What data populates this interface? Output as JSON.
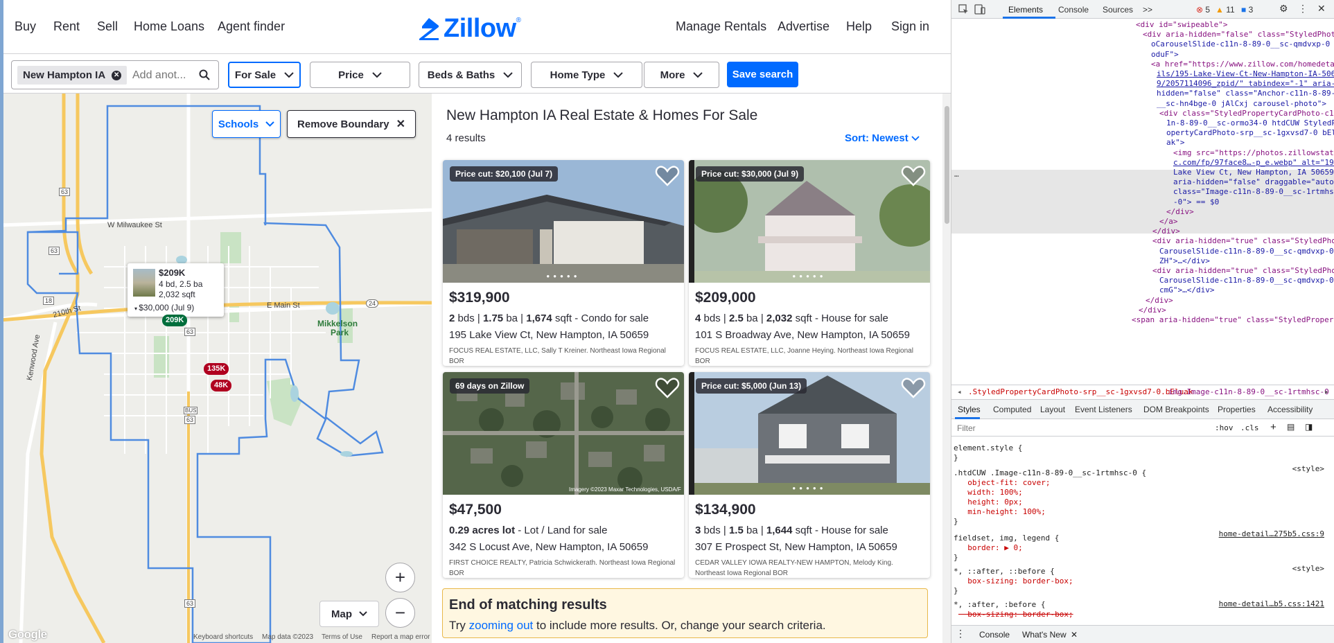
{
  "header": {
    "nav_left": [
      "Buy",
      "Rent",
      "Sell",
      "Home Loans",
      "Agent finder"
    ],
    "logo": "Zillow",
    "nav_right": [
      "Manage Rentals",
      "Advertise",
      "Help",
      "Sign in"
    ]
  },
  "filters": {
    "location_chip": "New Hampton IA",
    "search_placeholder": "Add anot...",
    "buttons": [
      "For Sale",
      "Price",
      "Beds & Baths",
      "Home Type",
      "More"
    ],
    "save_label": "Save search"
  },
  "map": {
    "schools_label": "Schools",
    "remove_boundary_label": "Remove Boundary",
    "map_type": "Map",
    "zoom_in": "+",
    "zoom_out": "−",
    "labels": {
      "milwaukee": "W Milwaukee St",
      "main": "E Main St",
      "st210": "210th St",
      "kenwood": "Kenwood Ave",
      "mikkelson1": "Mikkelson",
      "mikkelson2": "Park",
      "hwy63a": "63",
      "hwy63b": "63",
      "hwy63c": "63",
      "hwy63d": "63",
      "hwy63e": "63",
      "hwy18": "18",
      "hwy24": "24",
      "bus": "BUS"
    },
    "pins": [
      {
        "label": "209K",
        "color": "#006e3c"
      },
      {
        "label": "135K",
        "color": "#b00020"
      },
      {
        "label": "48K",
        "color": "#b00020"
      }
    ],
    "tooltip": {
      "price": "$209K",
      "beds_baths": "4 bd, 2.5 ba",
      "sqft": "2,032 sqft",
      "cut": "$30,000 (Jul 9)"
    },
    "attribution": {
      "google": "Google",
      "shortcuts": "Keyboard shortcuts",
      "data": "Map data ©2023",
      "terms": "Terms of Use",
      "report": "Report a map error"
    }
  },
  "results": {
    "title": "New Hampton IA Real Estate & Homes For Sale",
    "count": "4 results",
    "sort_label": "Sort: Newest",
    "listings": [
      {
        "badge": "Price cut: $20,100 (Jul 7)",
        "price": "$319,900",
        "beds": "2",
        "beds_unit": "bds",
        "baths": "1.75",
        "baths_unit": "ba",
        "sqft": "1,674",
        "sqft_unit": "sqft",
        "type": "Condo for sale",
        "address": "195 Lake View Ct, New Hampton, IA 50659",
        "broker": "FOCUS REAL ESTATE, LLC, Sally T Kreiner. Northeast Iowa Regional BOR"
      },
      {
        "badge": "Price cut: $30,000 (Jul 9)",
        "price": "$209,000",
        "beds": "4",
        "beds_unit": "bds",
        "baths": "2.5",
        "baths_unit": "ba",
        "sqft": "2,032",
        "sqft_unit": "sqft",
        "type": "House for sale",
        "address": "101 S Broadway Ave, New Hampton, IA 50659",
        "broker": "FOCUS REAL ESTATE, LLC, Joanne Heying. Northeast Iowa Regional BOR"
      },
      {
        "badge": "69 days on Zillow",
        "price": "$47,500",
        "lot": "0.29 acres lot",
        "type": "Lot / Land for sale",
        "address": "342 S Locust Ave, New Hampton, IA 50659",
        "broker": "FIRST CHOICE REALTY, Patricia Schwickerath. Northeast Iowa Regional BOR",
        "imagery_credit": "Imagery ©2023 Maxar Technologies, USDA/F"
      },
      {
        "badge": "Price cut: $5,000 (Jun 13)",
        "price": "$134,900",
        "beds": "3",
        "beds_unit": "bds",
        "baths": "1.5",
        "baths_unit": "ba",
        "sqft": "1,644",
        "sqft_unit": "sqft",
        "type": "House for sale",
        "address": "307 E Prospect St, New Hampton, IA 50659",
        "broker": "CEDAR VALLEY IOWA REALTY-NEW HAMPTON, Melody King. Northeast Iowa Regional BOR"
      }
    ],
    "end": {
      "heading": "End of matching results",
      "try": "Try ",
      "link": "zooming out",
      "rest": " to include more results. Or, change your search criteria."
    }
  },
  "devtools": {
    "tabs": [
      "Elements",
      "Console",
      "Sources",
      ">>"
    ],
    "badges": {
      "errors": "5",
      "warnings": "11",
      "info": "3"
    },
    "crumbs": [
      ".StyledPropertyCardPhoto-srp__sc-1gxvsd7-0.bEluak",
      "img.Image-c11n-8-89-0__sc-1rtmhsc-0"
    ],
    "style_tabs": [
      "Styles",
      "Computed",
      "Layout",
      "Event Listeners",
      "DOM Breakpoints",
      "Properties",
      "Accessibility"
    ],
    "filter_placeholder": "Filter",
    "filter_hov": ":hov",
    "filter_cls": ".cls",
    "drawer": [
      "Console",
      "What's New"
    ],
    "dom_lines": [
      {
        "t": "<div id=\"swipeable\">"
      },
      {
        "t": "<div aria-hidden=\"false\" class=\"StyledPhot"
      },
      {
        "t": "oCarouselSlide-c11n-8-89-0__sc-qmdvxp-0 gi"
      },
      {
        "t": "oduF\">"
      },
      {
        "t": "<a href=\"https://www.zillow.com/homedeta"
      },
      {
        "t": "ils/195-Lake-View-Ct-New-Hampton-IA-5065"
      },
      {
        "t": "9/2057114096_zpid/\" tabindex=\"-1\" aria-"
      },
      {
        "t": "hidden=\"false\" class=\"Anchor-c11n-8-89-0"
      },
      {
        "t": "__sc-hn4bge-0 jAlCxj carousel-photo\">"
      },
      {
        "t": "<div class=\"StyledPropertyCardPhoto-c1"
      },
      {
        "t": "1n-8-89-0__sc-ormo34-0 htdCUW StyledPr"
      },
      {
        "t": "opertyCardPhoto-srp__sc-1gxvsd7-0 bEluak"
      },
      {
        "t": "ak\">"
      },
      {
        "t": "<img src=\"https://photos.zillowstati"
      },
      {
        "t": "c.com/fp/97face8…-p_e.webp\" alt=\"195"
      },
      {
        "t": "Lake View Ct, New Hampton, IA 50659\""
      },
      {
        "t": "aria-hidden=\"false\" draggable=\"auto\""
      },
      {
        "t": "class=\"Image-c11n-8-89-0__sc-1rtmhsc"
      },
      {
        "t": "-0\"> == $0"
      },
      {
        "t": "</div>"
      },
      {
        "t": "</a>"
      },
      {
        "t": "</div>"
      },
      {
        "t": "<div aria-hidden=\"true\" class=\"StyledPhoto"
      },
      {
        "t": "CarouselSlide-c11n-8-89-0__sc-qmdvxp-0 hFA"
      },
      {
        "t": "ZH\">…</div>"
      },
      {
        "t": "<div aria-hidden=\"true\" class=\"StyledPhoto"
      },
      {
        "t": "CarouselSlide-c11n-8-89-0__sc-qmdvxp-0 gti"
      },
      {
        "t": "cmG\">…</div>"
      },
      {
        "t": "</div>"
      },
      {
        "t": "</div>"
      },
      {
        "t": "<span aria-hidden=\"true\" class=\"StyledPropert"
      }
    ],
    "rules": [
      {
        "t": "element.style {"
      },
      {
        "t": "}"
      },
      {
        "t": ".htdCUW .Image-c11n-8-89-0__sc-1rtmhsc-0 {"
      },
      {
        "t": "  object-fit: cover;"
      },
      {
        "t": "  width: 100%;"
      },
      {
        "t": "  height: 0px;"
      },
      {
        "t": "  min-height: 100%;"
      },
      {
        "t": "}"
      },
      {
        "t": "fieldset, img, legend {"
      },
      {
        "t": "  border: ▶ 0;"
      },
      {
        "t": "}"
      },
      {
        "t": "*, ::after, ::before {"
      },
      {
        "t": "  box-sizing: border-box;"
      },
      {
        "t": "}"
      },
      {
        "t": "*, :after, :before {"
      },
      {
        "t": "  box-sizing: border-box;"
      }
    ],
    "rule_sources": [
      "<style>",
      "home-detail…275b5.css:9",
      "<style>",
      "home-detail…b5.css:1421"
    ]
  }
}
